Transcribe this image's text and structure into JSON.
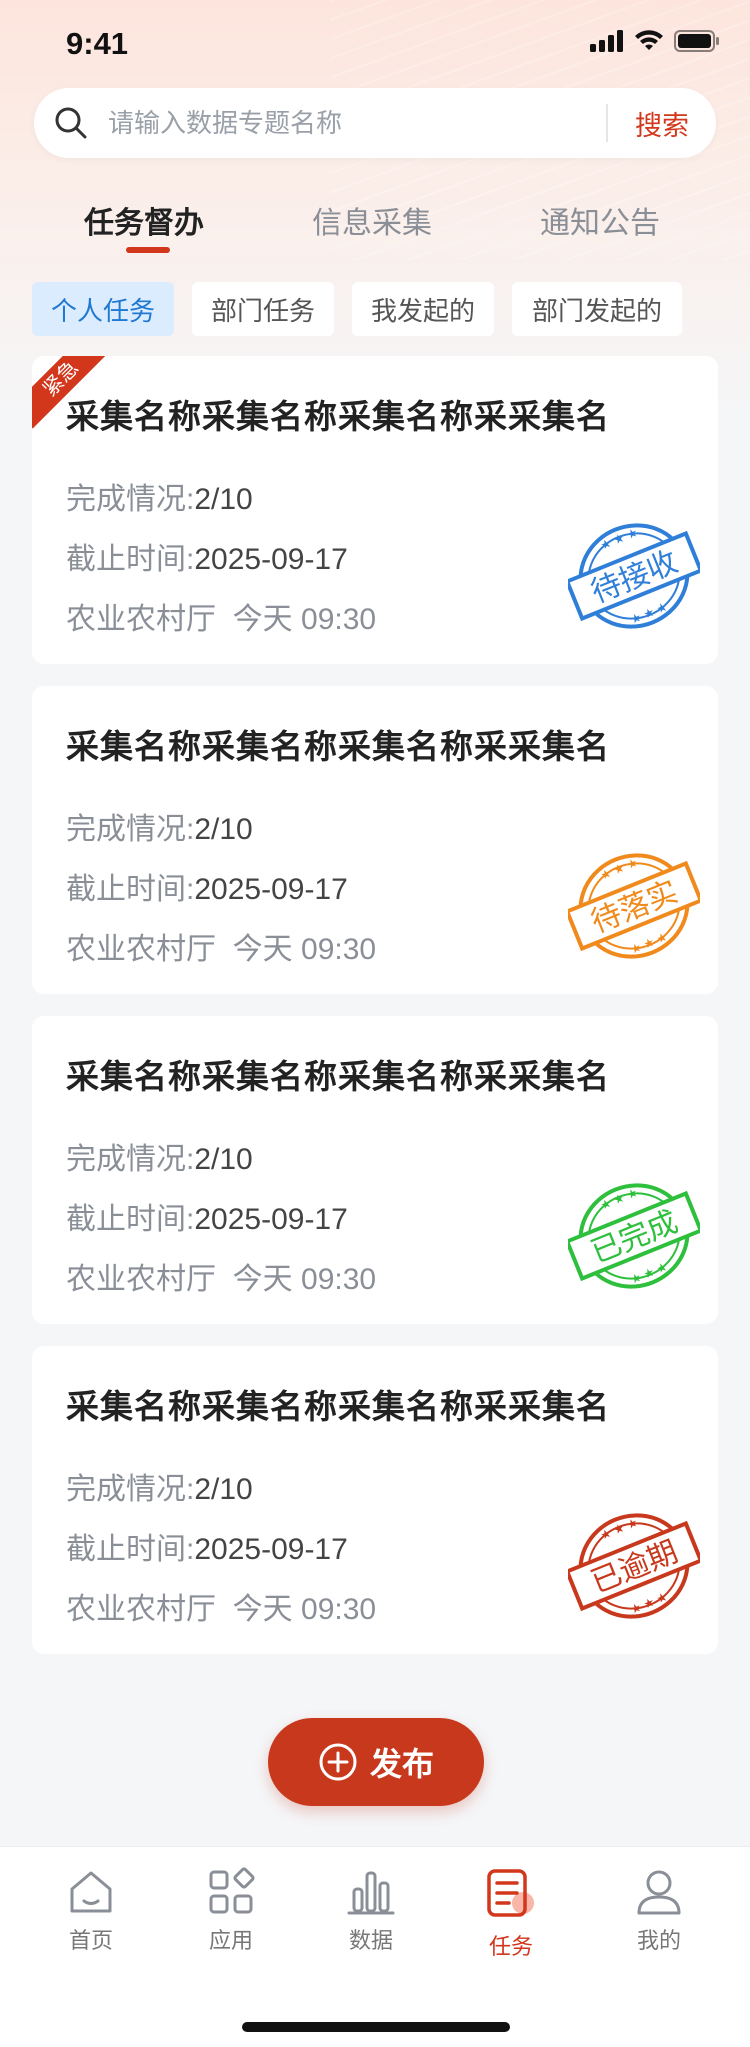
{
  "status_bar": {
    "time": "9:41"
  },
  "search": {
    "placeholder": "请输入数据专题名称",
    "button_label": "搜索"
  },
  "main_tabs": [
    {
      "label": "任务督办",
      "active": true
    },
    {
      "label": "信息采集",
      "active": false
    },
    {
      "label": "通知公告",
      "active": false
    }
  ],
  "sub_tabs": [
    {
      "label": "个人任务",
      "active": true
    },
    {
      "label": "部门任务",
      "active": false
    },
    {
      "label": "我发起的",
      "active": false
    },
    {
      "label": "部门发起的",
      "active": false
    }
  ],
  "labels": {
    "progress": "完成情况:",
    "deadline": "截止时间:"
  },
  "cards": [
    {
      "urgent": true,
      "urgent_label": "紧急",
      "title": "采集名称采集名称采集名称采采集名",
      "progress": "2/10",
      "deadline": "2025-09-17",
      "department": "农业农村厅",
      "time": "今天 09:30",
      "stamp": "待接收",
      "stamp_color": "#2f7fd8"
    },
    {
      "urgent": false,
      "title": "采集名称采集名称采集名称采采集名",
      "progress": "2/10",
      "deadline": "2025-09-17",
      "department": "农业农村厅",
      "time": "今天 09:30",
      "stamp": "待落实",
      "stamp_color": "#f08a1c"
    },
    {
      "urgent": false,
      "title": "采集名称采集名称采集名称采采集名",
      "progress": "2/10",
      "deadline": "2025-09-17",
      "department": "农业农村厅",
      "time": "今天 09:30",
      "stamp": "已完成",
      "stamp_color": "#2ebf3c"
    },
    {
      "urgent": false,
      "title": "采集名称采集名称采集名称采采集名",
      "progress": "2/10",
      "deadline": "2025-09-17",
      "department": "农业农村厅",
      "time": "今天 09:30",
      "stamp": "已逾期",
      "stamp_color": "#c8381c"
    }
  ],
  "publish": {
    "label": "发布"
  },
  "bottom_nav": [
    {
      "label": "首页",
      "icon": "home-icon"
    },
    {
      "label": "应用",
      "icon": "apps-icon"
    },
    {
      "label": "数据",
      "icon": "bar-chart-icon"
    },
    {
      "label": "任务",
      "icon": "task-icon",
      "active": true
    },
    {
      "label": "我的",
      "icon": "user-icon"
    }
  ],
  "colors": {
    "accent": "#d2361b",
    "sub_tab_active": "#1f78d1"
  }
}
